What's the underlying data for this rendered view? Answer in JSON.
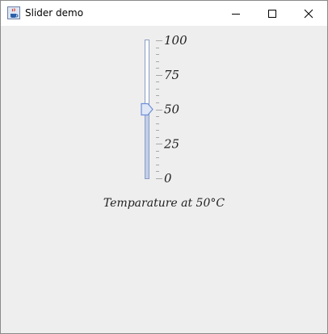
{
  "window": {
    "title": "Slider demo",
    "app_icon": "java-cup-icon",
    "controls": [
      "minimize-icon",
      "maximize-icon",
      "close-icon"
    ]
  },
  "slider": {
    "orientation": "vertical",
    "min": 0,
    "max": 100,
    "value": 50,
    "major_tick_spacing": 25,
    "minor_tick_spacing": 5,
    "labels": [
      "100",
      "75",
      "50",
      "25",
      "0"
    ],
    "accent_color": "#6d8fd6"
  },
  "caption": {
    "text": "Temparature at 50°C"
  }
}
